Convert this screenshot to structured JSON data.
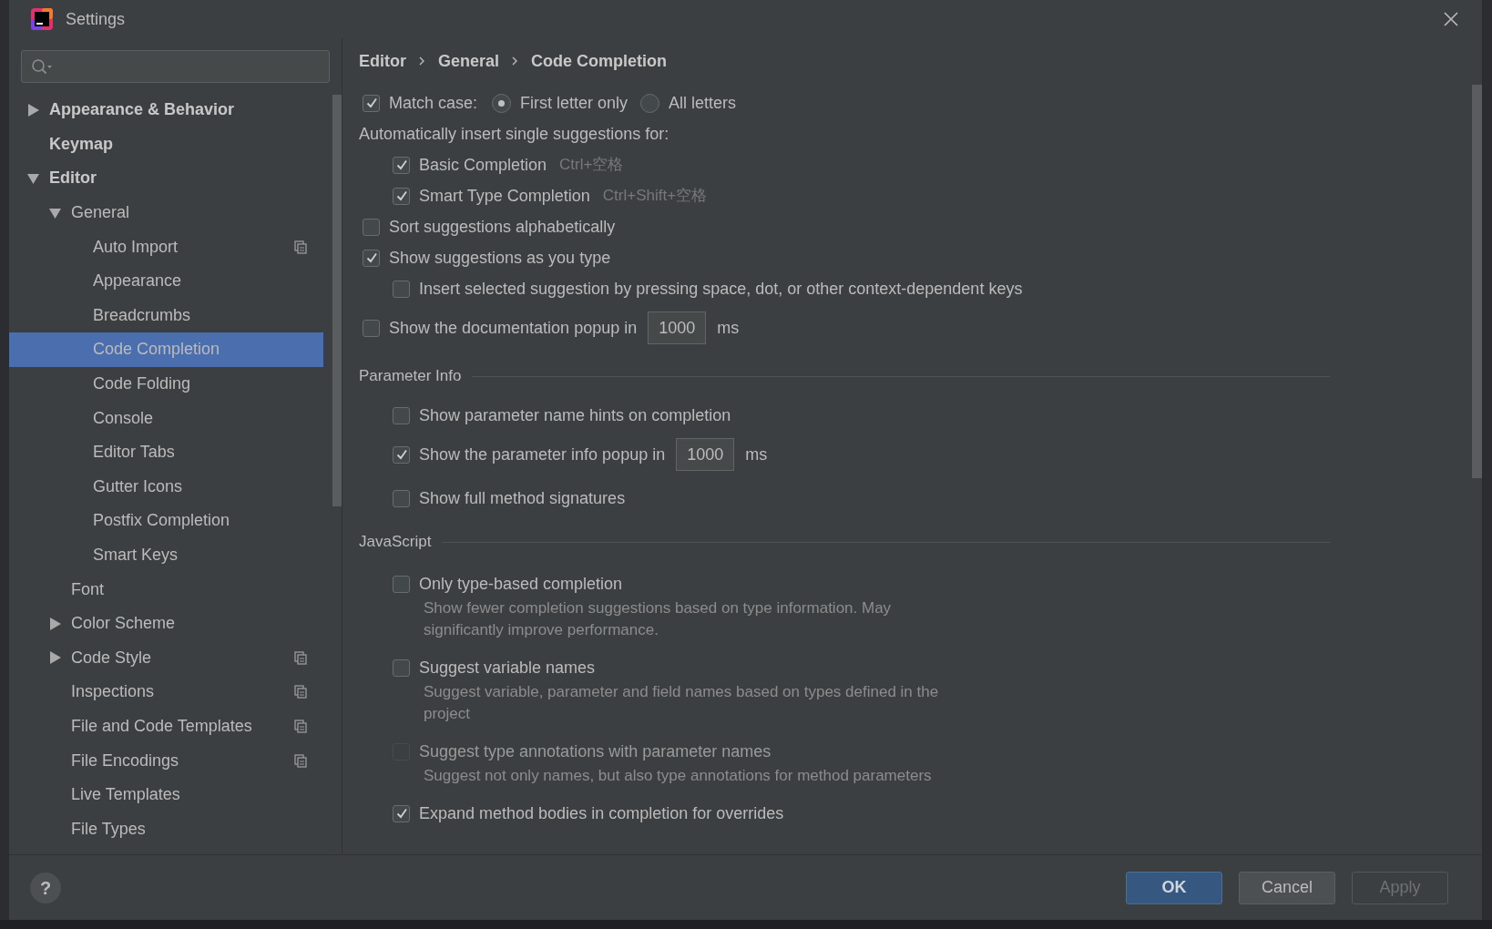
{
  "window": {
    "title": "Settings"
  },
  "sidebar": {
    "items": [
      {
        "label": "Appearance & Behavior",
        "expanded": false,
        "selected": false
      },
      {
        "label": "Keymap",
        "selected": false
      },
      {
        "label": "Editor",
        "expanded": true,
        "selected": false,
        "children": [
          {
            "label": "General",
            "expanded": true,
            "selected": false,
            "children": [
              {
                "label": "Auto Import",
                "selected": false,
                "project_scope": true
              },
              {
                "label": "Appearance",
                "selected": false
              },
              {
                "label": "Breadcrumbs",
                "selected": false
              },
              {
                "label": "Code Completion",
                "selected": true
              },
              {
                "label": "Code Folding",
                "selected": false
              },
              {
                "label": "Console",
                "selected": false
              },
              {
                "label": "Editor Tabs",
                "selected": false
              },
              {
                "label": "Gutter Icons",
                "selected": false
              },
              {
                "label": "Postfix Completion",
                "selected": false
              },
              {
                "label": "Smart Keys",
                "selected": false
              }
            ]
          },
          {
            "label": "Font",
            "selected": false
          },
          {
            "label": "Color Scheme",
            "expanded": false,
            "selected": false
          },
          {
            "label": "Code Style",
            "expanded": false,
            "selected": false,
            "project_scope": true
          },
          {
            "label": "Inspections",
            "selected": false,
            "project_scope": true
          },
          {
            "label": "File and Code Templates",
            "selected": false,
            "project_scope": true
          },
          {
            "label": "File Encodings",
            "selected": false,
            "project_scope": true
          },
          {
            "label": "Live Templates",
            "selected": false
          },
          {
            "label": "File Types",
            "selected": false
          }
        ]
      }
    ]
  },
  "breadcrumb": [
    "Editor",
    "General",
    "Code Completion"
  ],
  "options": [
    {
      "kind": "match_case",
      "label": "Match case:",
      "checked": true,
      "choices": [
        {
          "label": "First letter only",
          "selected": true
        },
        {
          "label": "All letters",
          "selected": false
        }
      ]
    },
    {
      "kind": "label",
      "text": "Automatically insert single suggestions for:",
      "children": [
        {
          "kind": "checkbox",
          "label": "Basic Completion",
          "shortcut": "Ctrl+空格",
          "checked": true
        },
        {
          "kind": "checkbox",
          "label": "Smart Type Completion",
          "shortcut": "Ctrl+Shift+空格",
          "checked": true
        }
      ]
    },
    {
      "kind": "checkbox",
      "label": "Sort suggestions alphabetically",
      "checked": false
    },
    {
      "kind": "checkbox",
      "label": "Show suggestions as you type",
      "checked": true,
      "children": [
        {
          "kind": "checkbox",
          "label": "Insert selected suggestion by pressing space, dot, or other context-dependent keys",
          "checked": false
        }
      ]
    },
    {
      "kind": "checkbox",
      "label": "Show the documentation popup in",
      "checked": false,
      "value": "1000",
      "unit": "ms"
    },
    {
      "kind": "section",
      "title": "Parameter Info",
      "children": [
        {
          "kind": "checkbox",
          "label": "Show parameter name hints on completion",
          "checked": false
        },
        {
          "kind": "checkbox",
          "label": "Show the parameter info popup in",
          "checked": true,
          "value": "1000",
          "unit": "ms"
        },
        {
          "kind": "checkbox",
          "label": "Show full method signatures",
          "checked": false
        }
      ]
    },
    {
      "kind": "section",
      "title": "JavaScript",
      "children": [
        {
          "kind": "checkbox",
          "label": "Only type-based completion",
          "checked": false,
          "disabled": false,
          "description": "Show fewer completion suggestions based on type information. May significantly improve performance."
        },
        {
          "kind": "checkbox",
          "label": "Suggest variable names",
          "checked": false,
          "disabled": false,
          "description": "Suggest variable, parameter and field names based on types defined in the project"
        },
        {
          "kind": "checkbox",
          "label": "Suggest type annotations with parameter names",
          "checked": false,
          "disabled": true,
          "description": "Suggest not only names, but also type annotations for method parameters"
        },
        {
          "kind": "checkbox",
          "label": "Expand method bodies in completion for overrides",
          "checked": true,
          "disabled": false
        }
      ]
    }
  ],
  "help": {
    "label": "?"
  },
  "buttons": [
    {
      "label": "OK",
      "default": true,
      "disabled": false
    },
    {
      "label": "Cancel",
      "default": false,
      "disabled": false
    },
    {
      "label": "Apply",
      "default": false,
      "disabled": true
    }
  ]
}
